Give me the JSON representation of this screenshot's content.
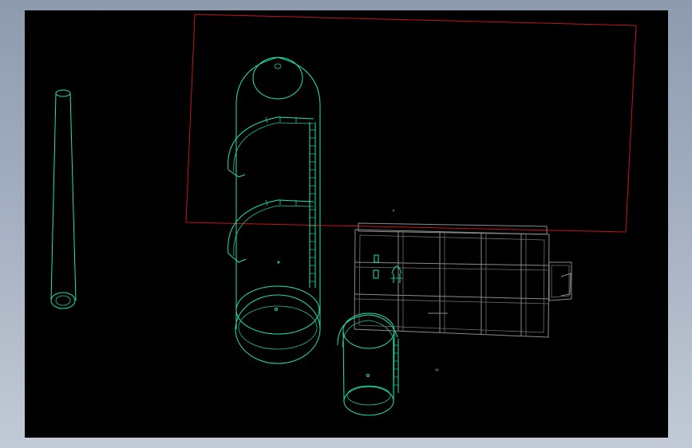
{
  "window": {
    "background_top": "#8e9aae",
    "background_bottom": "#c2cad6"
  },
  "viewport": {
    "background": "#000000",
    "colors": {
      "equipment": "#22e3b0",
      "steel_frame": "#8a8a8a",
      "selection": "#c0161c"
    }
  }
}
